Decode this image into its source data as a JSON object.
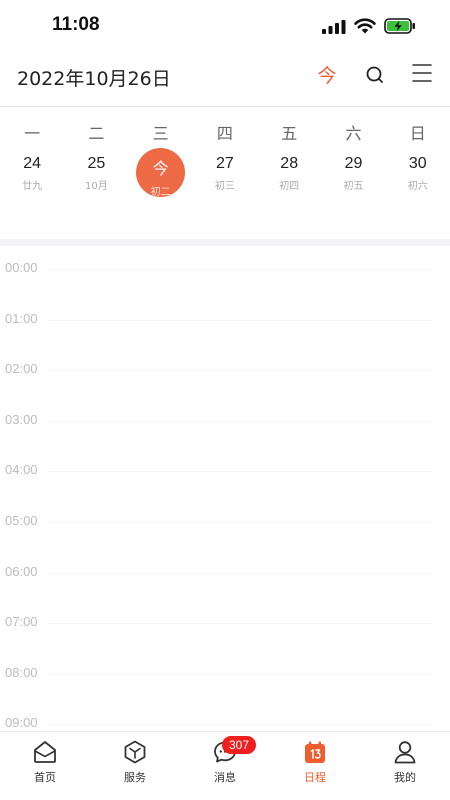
{
  "status_bar": {
    "time": "11:08"
  },
  "header": {
    "title": "2022年10月26日",
    "today_label": "今"
  },
  "week": {
    "weekdays": [
      "一",
      "二",
      "三",
      "四",
      "五",
      "六",
      "日"
    ],
    "dates": [
      {
        "day": "24",
        "lunar": "廿九"
      },
      {
        "day": "25",
        "lunar": "10月"
      },
      {
        "day": "今",
        "lunar": "初二"
      },
      {
        "day": "27",
        "lunar": "初三"
      },
      {
        "day": "28",
        "lunar": "初四"
      },
      {
        "day": "29",
        "lunar": "初五"
      },
      {
        "day": "30",
        "lunar": "初六"
      }
    ]
  },
  "timeline": {
    "hours": [
      "00:00",
      "01:00",
      "02:00",
      "03:00",
      "04:00",
      "05:00",
      "06:00",
      "07:00",
      "08:00",
      "09:00"
    ]
  },
  "tab_bar": {
    "tabs": [
      {
        "label": "首页",
        "icon": "home-icon"
      },
      {
        "label": "服务",
        "icon": "cube-icon"
      },
      {
        "label": "消息",
        "icon": "chat-bubble-icon",
        "badge": "307"
      },
      {
        "label": "日程",
        "icon": "calendar-icon"
      },
      {
        "label": "我的",
        "icon": "user-icon"
      }
    ]
  },
  "colors": {
    "accent": "#ee5d2e",
    "today_circle": "#ee6a45",
    "badge": "#f01f1f"
  }
}
